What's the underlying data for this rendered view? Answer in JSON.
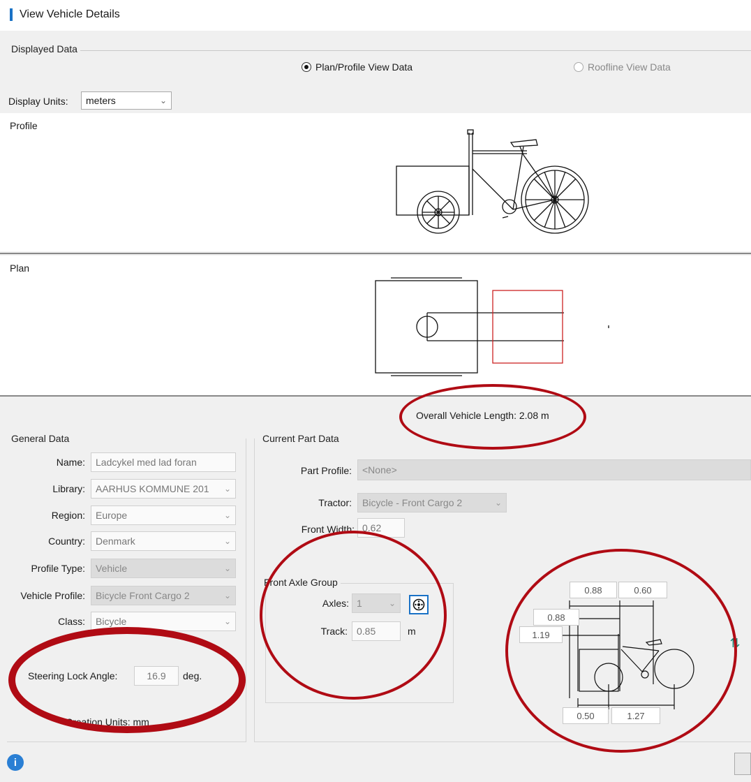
{
  "window": {
    "title": "View Vehicle Details"
  },
  "displayed_data": {
    "label": "Displayed Data",
    "options": [
      "Plan/Profile View Data",
      "Roofline View Data"
    ],
    "selected": "Plan/Profile View Data"
  },
  "display_units": {
    "label": "Display Units:",
    "value": "meters"
  },
  "views": {
    "profile_label": "Profile",
    "plan_label": "Plan"
  },
  "overall_length": "Overall Vehicle Length: 2.08 m",
  "general_data": {
    "label": "General Data",
    "name_label": "Name:",
    "name_value": "Ladcykel med lad foran",
    "library_label": "Library:",
    "library_value": "AARHUS KOMMUNE 201",
    "region_label": "Region:",
    "region_value": "Europe",
    "country_label": "Country:",
    "country_value": "Denmark",
    "profile_type_label": "Profile Type:",
    "profile_type_value": "Vehicle",
    "vehicle_profile_label": "Vehicle Profile:",
    "vehicle_profile_value": "Bicycle Front Cargo 2",
    "class_label": "Class:",
    "class_value": "Bicycle",
    "steering_label": "Steering Lock Angle:",
    "steering_value": "16.9",
    "steering_unit": "deg.",
    "creation_units": "Creation Units: mm"
  },
  "current_part": {
    "label": "Current Part Data",
    "part_profile_label": "Part Profile:",
    "part_profile_value": "<None>",
    "tractor_label": "Tractor:",
    "tractor_value": "Bicycle - Front Cargo 2",
    "front_width_label": "Front Width:",
    "front_width_value": "0.62",
    "axle_group_label": "Front Axle Group",
    "axles_label": "Axles:",
    "axles_value": "1",
    "track_label": "Track:",
    "track_value": "0.85",
    "track_unit": "m"
  },
  "dimensions": {
    "top_left": "0.88",
    "top_right": "0.60",
    "mid": "0.88",
    "left": "1.19",
    "bottom_left": "0.50",
    "bottom_right": "1.27"
  },
  "colors": {
    "highlight_ellipse": "#b00b14",
    "accent": "#1a72c6",
    "plan_red_box": "#cc2222"
  }
}
